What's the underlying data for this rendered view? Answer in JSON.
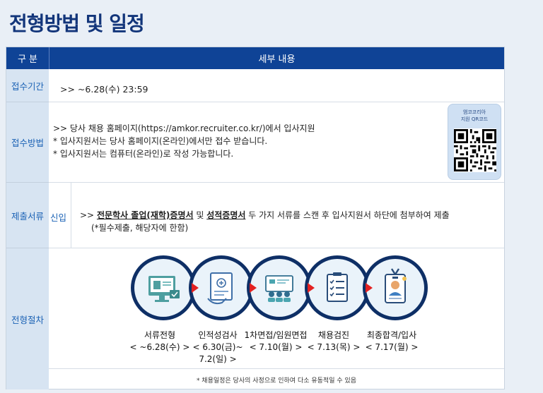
{
  "page": {
    "title": "전형방법 및 일정"
  },
  "table": {
    "header": {
      "col1": "구 분",
      "col2": "세부 내용"
    },
    "period": {
      "label": "접수기간",
      "text": ">> ~6.28(수) 23:59"
    },
    "method": {
      "label": "접수방법",
      "line1": ">> 당사 채용 홈페이지(https://amkor.recruiter.co.kr/)에서 입사지원",
      "line2": "* 입사지원서는 당사 홈페이지(온라인)에서만 접수 받습니다.",
      "line3": "* 입사지원서는 컴퓨터(온라인)로 작성 가능합니다.",
      "qr_caption_1": "앰코코리아",
      "qr_caption_2": "지원 QR코드"
    },
    "documents": {
      "label": "제출서류",
      "sublabel": "신입",
      "prefix": ">> ",
      "doc1": "전문학사 졸업(재학)증명서",
      "and": " 및 ",
      "doc2": "성적증명서",
      "suffix": " 두 가지 서류를 스캔 후 입사지원서 하단에 첨부하여 제출",
      "note": "(*필수제출, 해당자에 한함)"
    },
    "process": {
      "label": "전형절차",
      "steps": [
        {
          "name": "서류전형",
          "date": "< ~6.28(수) >",
          "date2": "",
          "icon": "computer-document-icon"
        },
        {
          "name": "인적성검사",
          "date": "< 6.30(금)~",
          "date2": "7.2(일) >",
          "icon": "aptitude-test-icon"
        },
        {
          "name": "1차면접/임원면접",
          "date": "< 7.10(월) >",
          "date2": "",
          "icon": "interview-icon"
        },
        {
          "name": "채용검진",
          "date": "< 7.13(목) >",
          "date2": "",
          "icon": "checklist-icon"
        },
        {
          "name": "최종합격/입사",
          "date": "< 7.17(월) >",
          "date2": "",
          "icon": "id-badge-icon"
        }
      ],
      "note": "* 채용일정은 당사의 사정으로 인하여 다소 유동적일 수 있음"
    }
  },
  "colors": {
    "title": "#12357a",
    "header_bg": "#0f4396",
    "label_bg": "#d7e4f2",
    "label_text": "#1b62b5",
    "arrow": "#e32121",
    "circle": "#0e2f66"
  }
}
